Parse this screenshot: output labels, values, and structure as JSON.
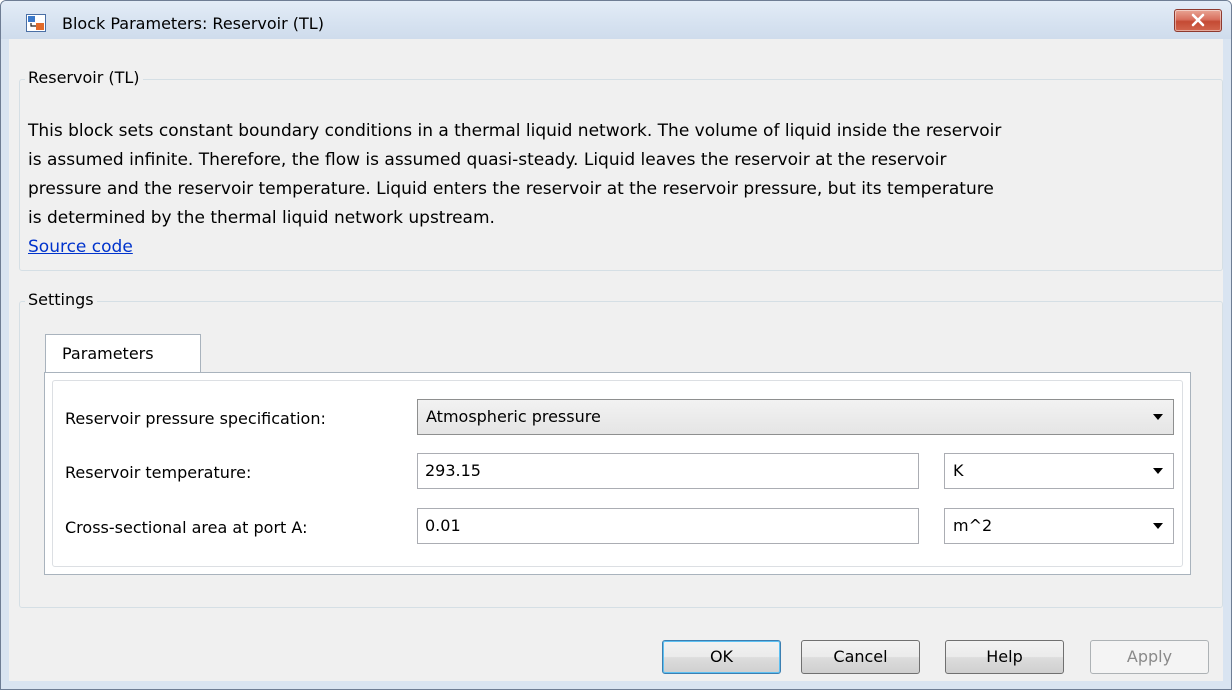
{
  "window": {
    "title": "Block Parameters: Reservoir (TL)",
    "close_label": "×"
  },
  "block_group": {
    "legend": "Reservoir (TL)",
    "description_lines": [
      "This block sets constant boundary conditions in a thermal liquid network. The volume of liquid inside the reservoir",
      "is assumed infinite. Therefore, the flow is assumed quasi-steady. Liquid leaves the reservoir at the reservoir",
      "pressure and the reservoir temperature. Liquid enters the reservoir at the reservoir pressure, but its temperature",
      "is determined by the thermal liquid network upstream."
    ],
    "link": "Source code"
  },
  "settings": {
    "legend": "Settings",
    "tab_label": "Parameters",
    "pressure_spec": {
      "label": "Reservoir pressure specification:",
      "value": "Atmospheric pressure"
    },
    "temperature": {
      "label": "Reservoir temperature:",
      "value": "293.15",
      "unit": "K"
    },
    "area": {
      "label": "Cross-sectional area at port A:",
      "value": "0.01",
      "unit": "m^2"
    }
  },
  "buttons": {
    "ok": "OK",
    "cancel": "Cancel",
    "help": "Help",
    "apply": "Apply"
  },
  "icons": {
    "app": "simulink-block-icon",
    "close": "close-icon",
    "dropdown": "chevron-down-icon"
  }
}
